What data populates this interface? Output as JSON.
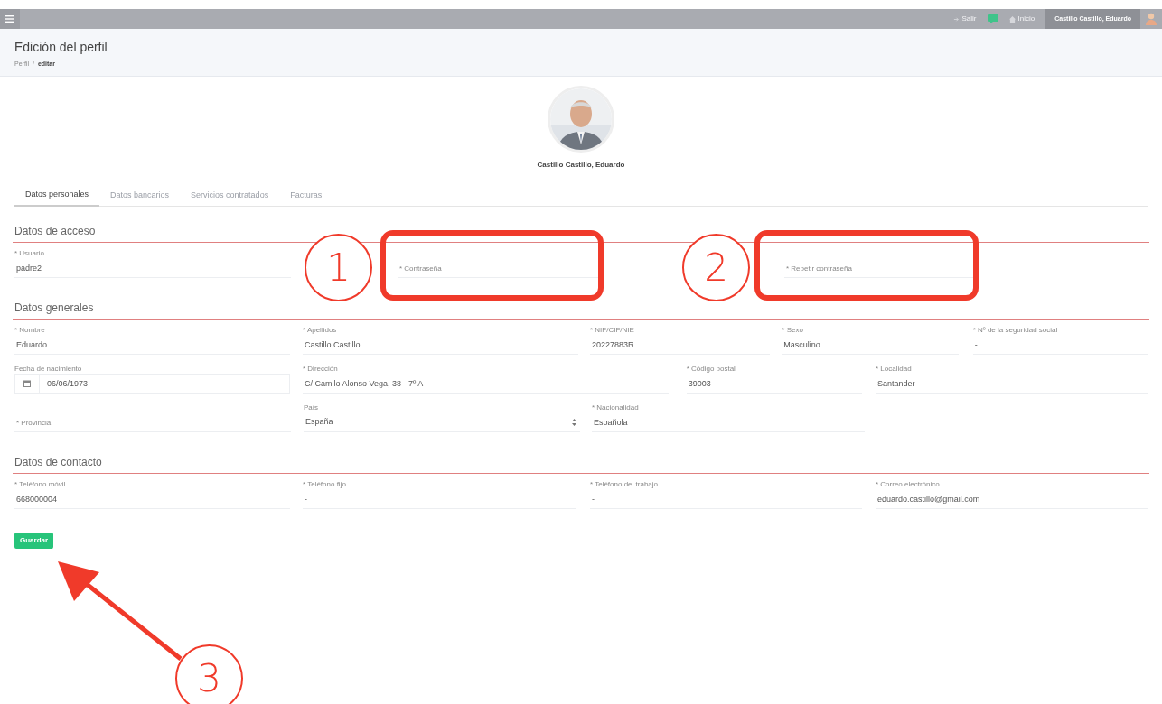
{
  "top_bar": {
    "links": [
      {
        "label": "Salir",
        "kind": "exit"
      },
      {
        "label": "Inicio",
        "kind": "home"
      }
    ],
    "user": "Castillo Castillo, Eduardo"
  },
  "header": {
    "title": "Edición del perfil",
    "breadcrumb_separator": "/",
    "breadcrumb": [
      {
        "label": "Perfil",
        "current": false
      },
      {
        "label": "editar",
        "current": true
      }
    ]
  },
  "profile": {
    "name": "Castillo Castillo, Eduardo"
  },
  "tabs": [
    {
      "label": "Datos personales",
      "selected": true
    },
    {
      "label": "Datos bancarios",
      "selected": false
    },
    {
      "label": "Servicios contratados",
      "selected": false
    },
    {
      "label": "Facturas",
      "selected": false
    }
  ],
  "sections": [
    {
      "title": "Datos de acceso",
      "rows": [
        [
          {
            "label": "* Usuario",
            "value": "padre2"
          },
          {
            "placeholder": "* Contraseña"
          },
          {
            "placeholder": "* Repetir contraseña"
          }
        ]
      ]
    },
    {
      "title": "Datos generales",
      "rows": [
        [
          {
            "label": "* Nombre",
            "value": "Eduardo"
          },
          {
            "label": "* Apellidos",
            "value": "Castillo Castillo"
          },
          {
            "label": "* NIF/CIF/NIE",
            "value": "20227883R"
          },
          {
            "label": "* Sexo",
            "value": "Masculino"
          },
          {
            "label": "* Nº de la seguridad social",
            "value": "-"
          }
        ],
        [
          {
            "label": "Fecha de nacimiento",
            "value": "06/06/1973",
            "kind": "date"
          },
          {
            "label": "* Dirección",
            "value": "C/ Camilo Alonso Vega, 38 - 7º A"
          },
          {
            "label": "* Código postal",
            "value": "39003"
          },
          {
            "label": "* Localidad",
            "value": "Santander"
          }
        ],
        [
          {
            "placeholder": "* Provincia"
          },
          {
            "label": "País",
            "value": "España",
            "kind": "select"
          },
          {
            "label": "* Nacionalidad",
            "value": "Española"
          }
        ]
      ]
    },
    {
      "title": "Datos de contacto",
      "rows": [
        [
          {
            "label": "* Teléfono móvil",
            "value": "668000004"
          },
          {
            "label": "* Teléfono fijo",
            "value": "-"
          },
          {
            "label": "* Teléfono del trabajo",
            "value": "-"
          },
          {
            "label": "* Correo electrónico",
            "value": "eduardo.castillo@gmail.com"
          }
        ]
      ]
    }
  ],
  "save_button": "Guardar",
  "annotations": [
    {
      "kind": "callout",
      "number": "1"
    },
    {
      "kind": "callout",
      "number": "2"
    },
    {
      "kind": "arrow",
      "number": "3"
    }
  ]
}
